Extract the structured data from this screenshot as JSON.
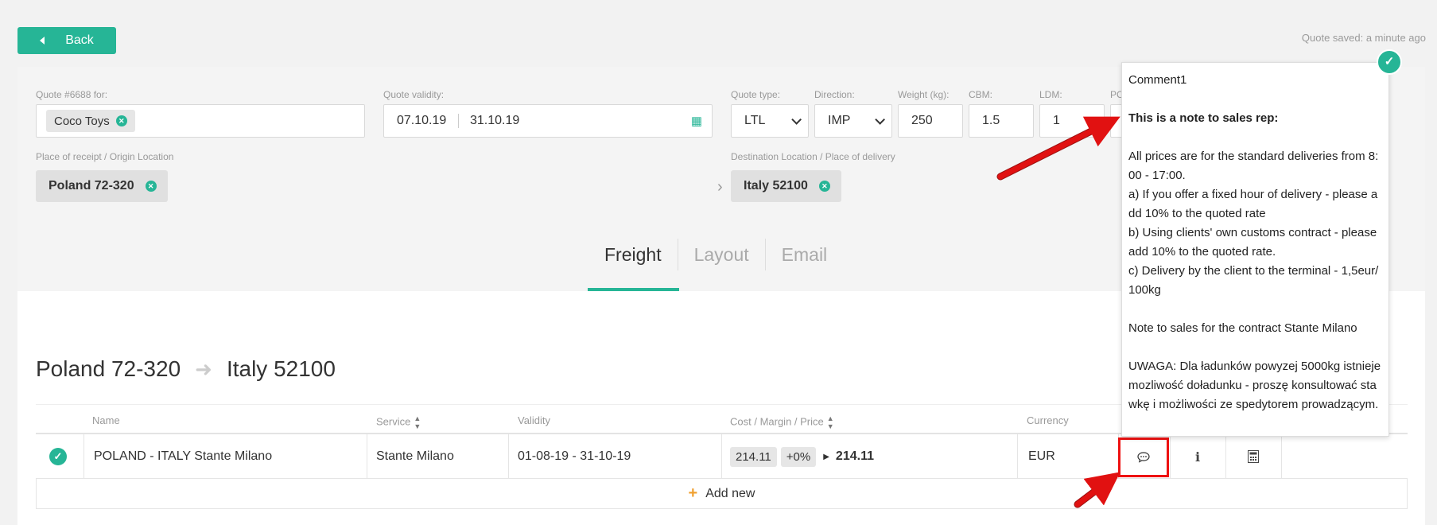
{
  "top": {
    "back_label": "Back",
    "saved_text": "Quote saved: a minute ago"
  },
  "quote": {
    "for_label": "Quote #6688 for:",
    "customer": "Coco Toys",
    "validity_label": "Quote validity:",
    "valid_from": "07.10.19",
    "valid_to": "31.10.19",
    "type_label": "Quote type:",
    "type_value": "LTL",
    "direction_label": "Direction:",
    "direction_value": "IMP",
    "weight_label": "Weight (kg):",
    "weight_value": "250",
    "cbm_label": "CBM:",
    "cbm_value": "1.5",
    "ldm_label": "LDM:",
    "ldm_value": "1",
    "pc_label": "PC",
    "origin_label": "Place of receipt / Origin Location",
    "origin_value": "Poland 72-320",
    "dest_label": "Destination Location / Place of delivery",
    "dest_value": "Italy 52100"
  },
  "tabs": [
    "Freight",
    "Layout",
    "Email"
  ],
  "route": {
    "from": "Poland 72-320",
    "to": "Italy 52100"
  },
  "table": {
    "headers": {
      "name": "Name",
      "service": "Service",
      "validity": "Validity",
      "cost": "Cost / Margin / Price",
      "currency": "Currency"
    },
    "rows": [
      {
        "name": "POLAND - ITALY Stante Milano",
        "service": "Stante Milano",
        "validity": "01-08-19 - 31-10-19",
        "cost": "214.11",
        "margin": "+0%",
        "price": "214.11",
        "currency": "EUR"
      }
    ],
    "add_new_label": "Add new"
  },
  "comment": {
    "title": "Comment1",
    "heading": "This is a note to sales rep:",
    "line1": "All prices are for the standard deliveries from 8:00 - 17:00.",
    "line2": "a) If you offer a fixed hour of delivery - please add 10% to the quoted rate",
    "line3": "b) Using clients' own customs contract - please add 10% to the quoted rate.",
    "line4": "c) Delivery by the client to the terminal - 1,5eur/100kg",
    "line5": "Note to sales for the contract Stante Milano",
    "line6": "UWAGA: Dla ładunków powyzej 5000kg istnieje mozliwość doładunku - proszę konsultować stawkę i możliwości ze spedytorem prowadzącym."
  },
  "colors": {
    "accent": "#26b596",
    "highlight": "#e11111",
    "add_icon": "#f0a030"
  }
}
